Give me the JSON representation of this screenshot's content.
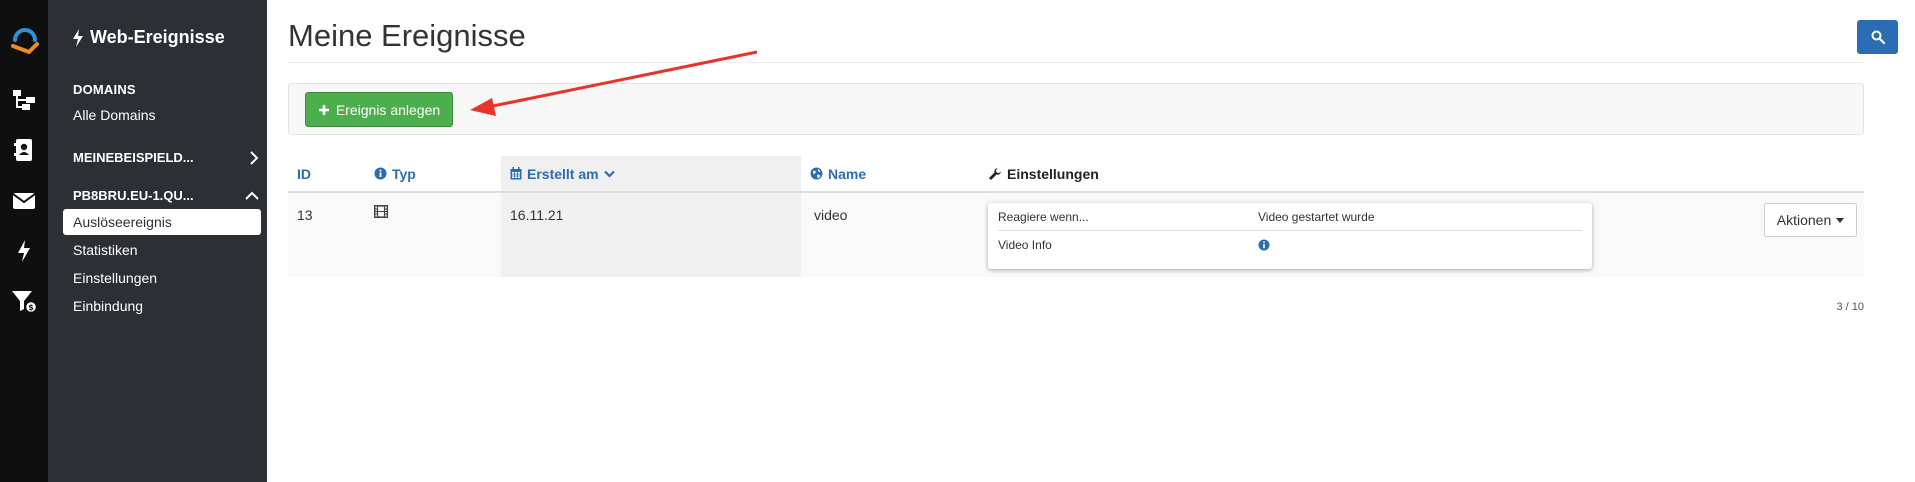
{
  "rail": {
    "items": [
      "workflow-icon",
      "contact-card-icon",
      "envelope-icon",
      "bolt-icon",
      "filter-dollar-icon"
    ]
  },
  "sidebar": {
    "title": "Web-Ereignisse",
    "domains_heading": "DOMAINS",
    "all_domains": "Alle Domains",
    "group1": "MEINEBEISPIELD...",
    "group2": "PB8BRU.EU-1.QU...",
    "items": [
      {
        "label": "Auslöseereignis",
        "active": true
      },
      {
        "label": "Statistiken",
        "active": false
      },
      {
        "label": "Einstellungen",
        "active": false
      },
      {
        "label": "Einbindung",
        "active": false
      }
    ]
  },
  "main": {
    "title": "Meine Ereignisse",
    "create_button": "Ereignis anlegen",
    "columns": {
      "id": "ID",
      "type": "Typ",
      "created": "Erstellt am",
      "name": "Name",
      "settings": "Einstellungen"
    },
    "rows": [
      {
        "id": "13",
        "type_icon": "film-icon",
        "created": "16.11.21",
        "name": "video",
        "settings": [
          {
            "key": "Reagiere wenn...",
            "value": "Video gestartet wurde"
          },
          {
            "key": "Video Info",
            "value_icon": "info-circle-icon"
          }
        ],
        "actions_label": "Aktionen"
      }
    ],
    "pager": "3 / 10"
  },
  "colors": {
    "rail": "#0f0f0f",
    "sidebar": "#2c3034",
    "primary": "#2a6db5",
    "success": "#4cae4c",
    "annotation_arrow": "#e8332a"
  }
}
